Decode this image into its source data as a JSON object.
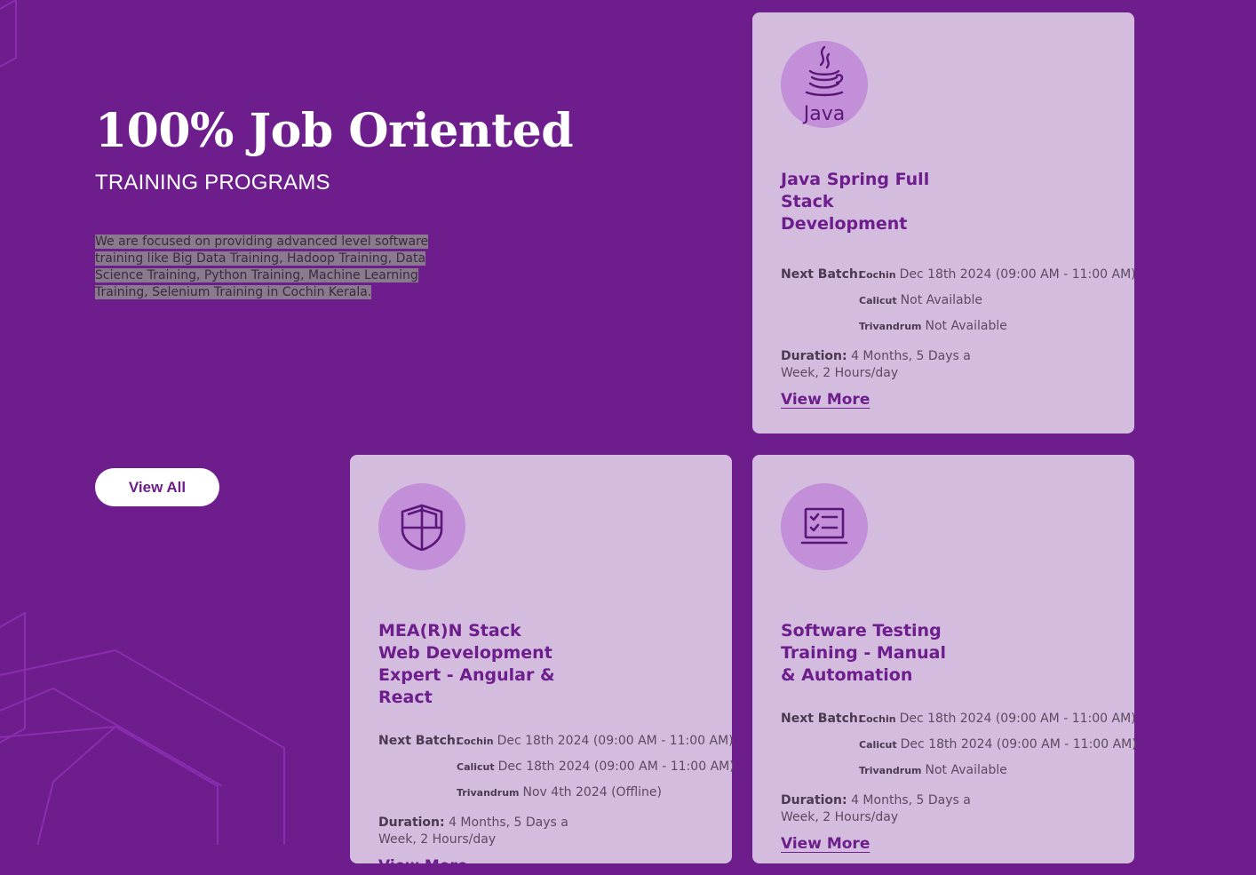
{
  "colors": {
    "background": "#6d1d8c",
    "card": "#d4bcdf",
    "accent": "#6d1d8c",
    "icon_circle": "#c28fd8"
  },
  "hero": {
    "title": "100% Job Oriented",
    "subtitle": "TRAINING PROGRAMS",
    "description": "We are focused on providing advanced level software training like Big Data Training, Hadoop Training, Data Science Training, Python Training, Machine Learning Training, Selenium Training in Cochin Kerala."
  },
  "view_all_label": "View All",
  "courses": [
    {
      "icon": "java-icon",
      "icon_text": "Java",
      "title": "Java Spring Full Stack Development",
      "next_batch_label": "Next Batch:",
      "batches": [
        {
          "city": "Cochin",
          "value": "Dec 18th 2024 (09:00 AM - 11:00 AM)"
        },
        {
          "city": "Calicut",
          "value": "Not Available"
        },
        {
          "city": "Trivandrum",
          "value": "Not Available"
        }
      ],
      "duration_label": "Duration:",
      "duration": "4 Months, 5 Days a Week, 2 Hours/day",
      "view_more": "View More"
    },
    {
      "icon": "shield-icon",
      "title": "MEA(R)N Stack Web Development Expert - Angular & React",
      "next_batch_label": "Next Batch:",
      "batches": [
        {
          "city": "Cochin",
          "value": "Dec 18th 2024 (09:00 AM - 11:00 AM)"
        },
        {
          "city": "Calicut",
          "value": "Dec 18th 2024 (09:00 AM - 11:00 AM)"
        },
        {
          "city": "Trivandrum",
          "value": "Nov 4th 2024 (Offline)"
        }
      ],
      "duration_label": "Duration:",
      "duration": "4 Months, 5 Days a Week, 2 Hours/day",
      "view_more": "View More"
    },
    {
      "icon": "laptop-checklist-icon",
      "title": "Software Testing Training - Manual & Automation",
      "next_batch_label": "Next Batch:",
      "batches": [
        {
          "city": "Cochin",
          "value": "Dec 18th 2024 (09:00 AM - 11:00 AM)"
        },
        {
          "city": "Calicut",
          "value": "Dec 18th 2024 (09:00 AM - 11:00 AM)"
        },
        {
          "city": "Trivandrum",
          "value": "Not Available"
        }
      ],
      "duration_label": "Duration:",
      "duration": "4 Months, 5 Days a Week, 2 Hours/day",
      "view_more": "View More"
    }
  ]
}
